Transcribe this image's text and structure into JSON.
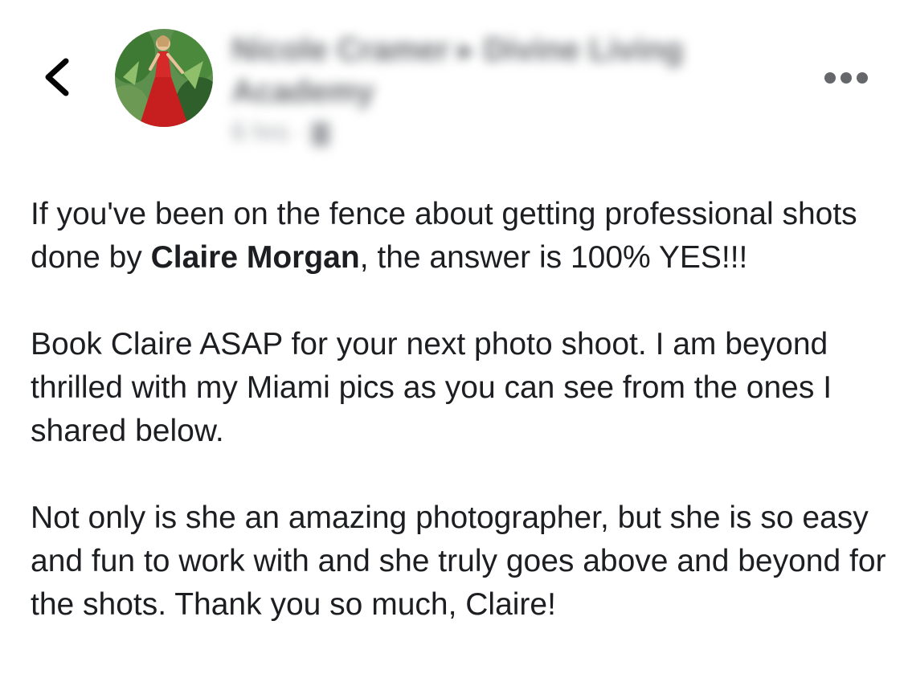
{
  "header": {
    "author_name": "Nicole Cramer",
    "group_separator": "▸",
    "group_name": "Divine Living Academy",
    "timestamp": "6 hrs",
    "privacy_separator": "·",
    "privacy_icon": "group-privacy-icon"
  },
  "icons": {
    "back": "chevron-left-icon",
    "more": "more-horizontal-icon"
  },
  "post": {
    "p1_before": "If you've been on the fence about getting professional shots done by ",
    "p1_mention": "Claire Morgan",
    "p1_after": ", the answer is 100% YES!!!",
    "p2": "Book Claire ASAP for your next photo shoot. I am beyond thrilled with my Miami pics as you can see from the ones I shared below.",
    "p3": "Not only is she an amazing photographer, but she is so easy and fun to work with and she truly goes above and beyond for the shots. Thank you so much, Claire!"
  },
  "colors": {
    "text": "#1c1e21",
    "back_icon": "#050505",
    "more_dots": "#65676b",
    "avatar_dress": "#d62a2a",
    "avatar_foliage": "#3f7a35"
  }
}
